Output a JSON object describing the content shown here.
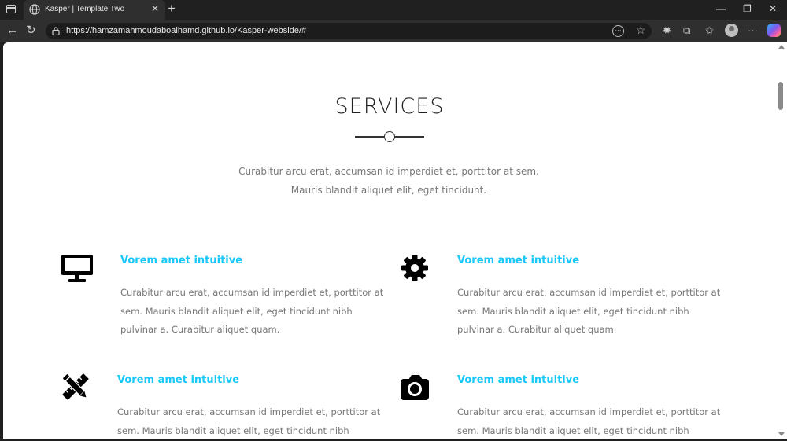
{
  "browser": {
    "tab_title": "Kasper | Template Two",
    "tab_close": "✕",
    "new_tab": "+",
    "url": "https://hamzamahmoudaboalhamd.github.io/Kasper-webside/#",
    "window_controls": {
      "minimize": "—",
      "restore": "❐",
      "close": "✕"
    },
    "icons": [
      "back-icon",
      "refresh-icon",
      "lock-icon",
      "reader-icon",
      "favorite-star-icon",
      "extension-icon",
      "puzzle-icon",
      "favorites-icon",
      "profile-avatar",
      "more-icon",
      "copilot-icon"
    ]
  },
  "services": {
    "title": "SERVICES",
    "description": "Curabitur arcu erat, accumsan id imperdiet et, porttitor at sem. Mauris blandit aliquet elit, eget tincidunt.",
    "items": [
      {
        "icon": "desktop-icon",
        "title": "Vorem amet intuitive",
        "text": "Curabitur arcu erat, accumsan id imperdiet et, porttitor at sem. Mauris blandit aliquet elit, eget tincidunt nibh pulvinar a. Curabitur aliquet quam."
      },
      {
        "icon": "gear-icon",
        "title": "Vorem amet intuitive",
        "text": "Curabitur arcu erat, accumsan id imperdiet et, porttitor at sem. Mauris blandit aliquet elit, eget tincidunt nibh pulvinar a. Curabitur aliquet quam."
      },
      {
        "icon": "pencil-ruler-icon",
        "title": "Vorem amet intuitive",
        "text": "Curabitur arcu erat, accumsan id imperdiet et, porttitor at sem. Mauris blandit aliquet elit, eget tincidunt nibh pulvinar"
      },
      {
        "icon": "camera-icon",
        "title": "Vorem amet intuitive",
        "text": "Curabitur arcu erat, accumsan id imperdiet et, porttitor at sem. Mauris blandit aliquet elit, eget tincidunt nibh pulvinar"
      }
    ]
  },
  "colors": {
    "accent": "#19c8fa",
    "text": "#777777",
    "heading": "#222222"
  }
}
